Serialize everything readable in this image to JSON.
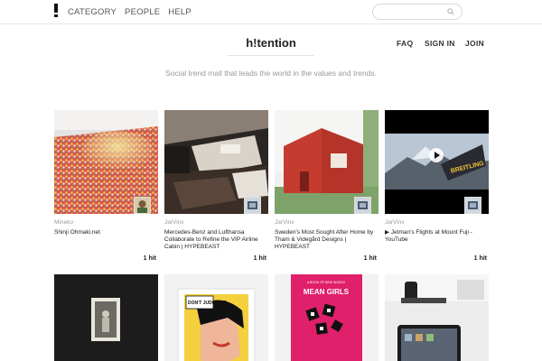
{
  "topbar": {
    "logo": "!",
    "nav": [
      "CATEGORY",
      "PEOPLE",
      "HELP"
    ],
    "search_placeholder": ""
  },
  "header": {
    "brand": "h!tention",
    "auth": [
      "FAQ",
      "SIGN IN",
      "JOIN"
    ],
    "tagline": "Social trend mall that leads the world in the values and trends."
  },
  "cards": [
    {
      "user": "Mineko",
      "title": "Shinji Ohmaki.net",
      "hits": "1 hit"
    },
    {
      "user": "JarVinx",
      "title": "Mercedes-Benz and Lufthansa Collaborate to Refine the VIP Airline Cabin | HYPEBEAST",
      "hits": "1 hit"
    },
    {
      "user": "JarVinx",
      "title": "Sweden's Most Sought After Home by Tham & Videgård Designs | HYPEBEAST",
      "hits": "1 hit"
    },
    {
      "user": "JarVinx",
      "title": "▶ Jetman's Flights at Mount Fuji - YouTube",
      "hits": "1 hit"
    }
  ],
  "row2": {
    "card2_text": "DON'T JUDGE ME",
    "card3_small": "A BOOK OF NEW WORLD",
    "card3_title": "MEAN GIRLS"
  },
  "video_overlay_text": "BREITLING",
  "colors": {
    "accent_red": "#c9443a",
    "pink": "#e0206a"
  }
}
